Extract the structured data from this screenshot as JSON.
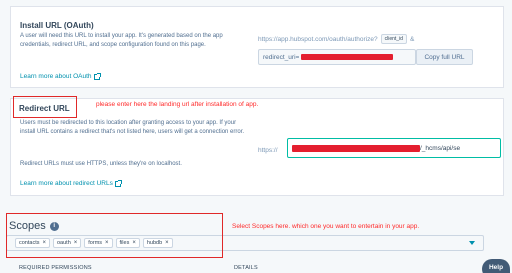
{
  "install": {
    "title": "Install URL (OAuth)",
    "description": "A user will need this URL to install your app. It's generated based on the app credentials, redirect URL, and scope configuration found on this page.",
    "learn_more": "Learn more about OAuth",
    "url_prefix": "https://app.hubspot.com/oauth/authorize?",
    "client_id_token": "client_id",
    "url_suffix": "&",
    "field_value": "redirect_uri=",
    "copy_label": "Copy full URL"
  },
  "redirect": {
    "title": "Redirect URL",
    "description": "Users must be redirected to this location after granting access to your app. If your install URL contains a redirect that's not listed here, users will get a connection error.",
    "note": "Redirect URLs must use HTTPS, unless they're on localhost.",
    "learn_more": "Learn more about redirect URLs",
    "scheme": "https://",
    "path_visible": "/_hcms/api/se"
  },
  "scopes": {
    "title": "Scopes",
    "info_glyph": "i",
    "selected": [
      {
        "label": "contacts"
      },
      {
        "label": "oauth"
      },
      {
        "label": "forms"
      },
      {
        "label": "files"
      },
      {
        "label": "hubdb"
      }
    ],
    "remove_glyph": "×",
    "columns": [
      "REQUIRED PERMISSIONS",
      "DETAILS"
    ]
  },
  "annotations": {
    "redirect_note": "please enter here the landing url after installation of app.",
    "scopes_note": "Select Scopes here. which one you want to entertain in your app."
  },
  "help": {
    "label": "Help"
  },
  "colors": {
    "accent": "#0091ae",
    "annotation": "#e02929",
    "help": "#425b76"
  }
}
